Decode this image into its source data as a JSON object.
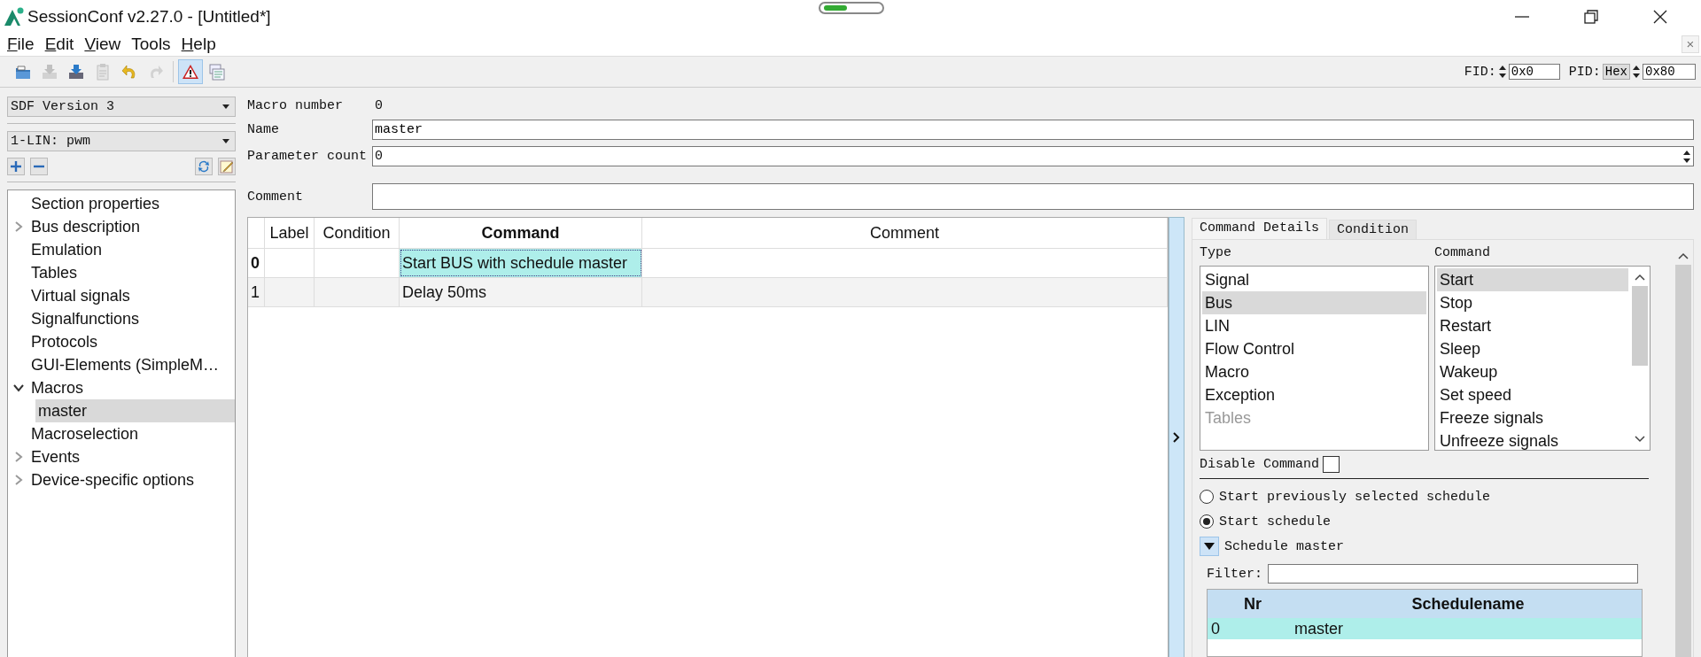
{
  "window": {
    "title": "SessionConf v2.27.0 - [Untitled*]",
    "side_close": "×"
  },
  "menu": [
    {
      "label": "File",
      "access_key": true
    },
    {
      "label": "Edit",
      "access_key": true
    },
    {
      "label": "View",
      "access_key": true
    },
    {
      "label": "Tools",
      "access_key": false
    },
    {
      "label": "Help",
      "access_key": true
    }
  ],
  "toolbar": [
    {
      "kind": "open",
      "disabled": false,
      "pressed": false
    },
    {
      "kind": "import",
      "disabled": true,
      "pressed": false
    },
    {
      "kind": "save",
      "disabled": false,
      "pressed": false
    },
    {
      "kind": "clipboard",
      "disabled": true,
      "pressed": false
    },
    {
      "kind": "undo",
      "disabled": false,
      "pressed": false
    },
    {
      "kind": "redo",
      "disabled": true,
      "pressed": false
    },
    {
      "kind": "warning",
      "disabled": false,
      "pressed": true
    },
    {
      "kind": "log",
      "disabled": false,
      "pressed": false
    }
  ],
  "ids": {
    "fid_label": "FID:",
    "fid_value": "0x0",
    "pid_label": "PID:",
    "pid_format": "Hex",
    "pid_value": "0x80"
  },
  "sidebar": {
    "version": "SDF Version 3",
    "bus": "1-LIN: pwm",
    "items": [
      {
        "label": "Section properties",
        "selected": false
      },
      {
        "label": "Bus description",
        "has_children": true,
        "expanded": false,
        "selected": false
      },
      {
        "label": "Emulation",
        "selected": false
      },
      {
        "label": "Tables",
        "selected": false
      },
      {
        "label": "Virtual signals",
        "selected": false
      },
      {
        "label": "Signalfunctions",
        "selected": false
      },
      {
        "label": "Protocols",
        "selected": false
      },
      {
        "label": "GUI-Elements (SimpleM…",
        "selected": false
      },
      {
        "label": "Macros",
        "has_children": true,
        "expanded": true,
        "selected": false,
        "children": [
          {
            "label": "master",
            "selected": true
          }
        ]
      },
      {
        "label": "Macroselection",
        "selected": false
      },
      {
        "label": "Events",
        "has_children": true,
        "expanded": false,
        "selected": false
      },
      {
        "label": "Device-specific options",
        "has_children": true,
        "expanded": false,
        "selected": false
      }
    ]
  },
  "form": {
    "macro_number": {
      "label": "Macro number",
      "value": "0"
    },
    "name": {
      "label": "Name",
      "value": "master"
    },
    "parameter_count": {
      "label": "Parameter count",
      "value": "0"
    },
    "comment": {
      "label": "Comment"
    }
  },
  "table": {
    "columns": [
      {
        "label": "Label",
        "current": false
      },
      {
        "label": "Condition",
        "current": false
      },
      {
        "label": "Command",
        "current": true
      },
      {
        "label": "Comment",
        "current": false
      }
    ],
    "rows": [
      {
        "number": "0",
        "command": "Start BUS with schedule master",
        "current": true
      },
      {
        "number": "1",
        "command": "Delay 50ms",
        "current": false
      }
    ]
  },
  "details": {
    "tabs": [
      {
        "label": "Command Details",
        "selected": true
      },
      {
        "label": "Condition",
        "selected": false
      }
    ],
    "type_label": "Type",
    "command_label": "Command",
    "types": [
      {
        "label": "Signal",
        "selected": false,
        "disabled": false
      },
      {
        "label": "Bus",
        "selected": true,
        "disabled": false
      },
      {
        "label": "LIN",
        "selected": false,
        "disabled": false
      },
      {
        "label": "Flow Control",
        "selected": false,
        "disabled": false
      },
      {
        "label": "Macro",
        "selected": false,
        "disabled": false
      },
      {
        "label": "Exception",
        "selected": false,
        "disabled": false
      },
      {
        "label": "Tables",
        "selected": false,
        "disabled": true
      }
    ],
    "commands": [
      {
        "label": "Start",
        "selected": true
      },
      {
        "label": "Stop",
        "selected": false
      },
      {
        "label": "Restart",
        "selected": false
      },
      {
        "label": "Sleep",
        "selected": false
      },
      {
        "label": "Wakeup",
        "selected": false
      },
      {
        "label": "Set speed",
        "selected": false
      },
      {
        "label": "Freeze signals",
        "selected": false
      },
      {
        "label": "Unfreeze signals",
        "selected": false
      }
    ],
    "disable_command": {
      "label": "Disable Command",
      "checked": false
    },
    "options": [
      {
        "label": "Start previously selected schedule",
        "selected": false
      },
      {
        "label": "Start schedule",
        "selected": true
      }
    ],
    "schedule": {
      "label": "Schedule master",
      "expanded": true
    },
    "filter": {
      "label": "Filter:"
    },
    "schedule_table": {
      "columns": [
        "Nr",
        "Schedulename"
      ],
      "rows": [
        {
          "nr": "0",
          "name": "master",
          "selected": true
        }
      ]
    }
  }
}
